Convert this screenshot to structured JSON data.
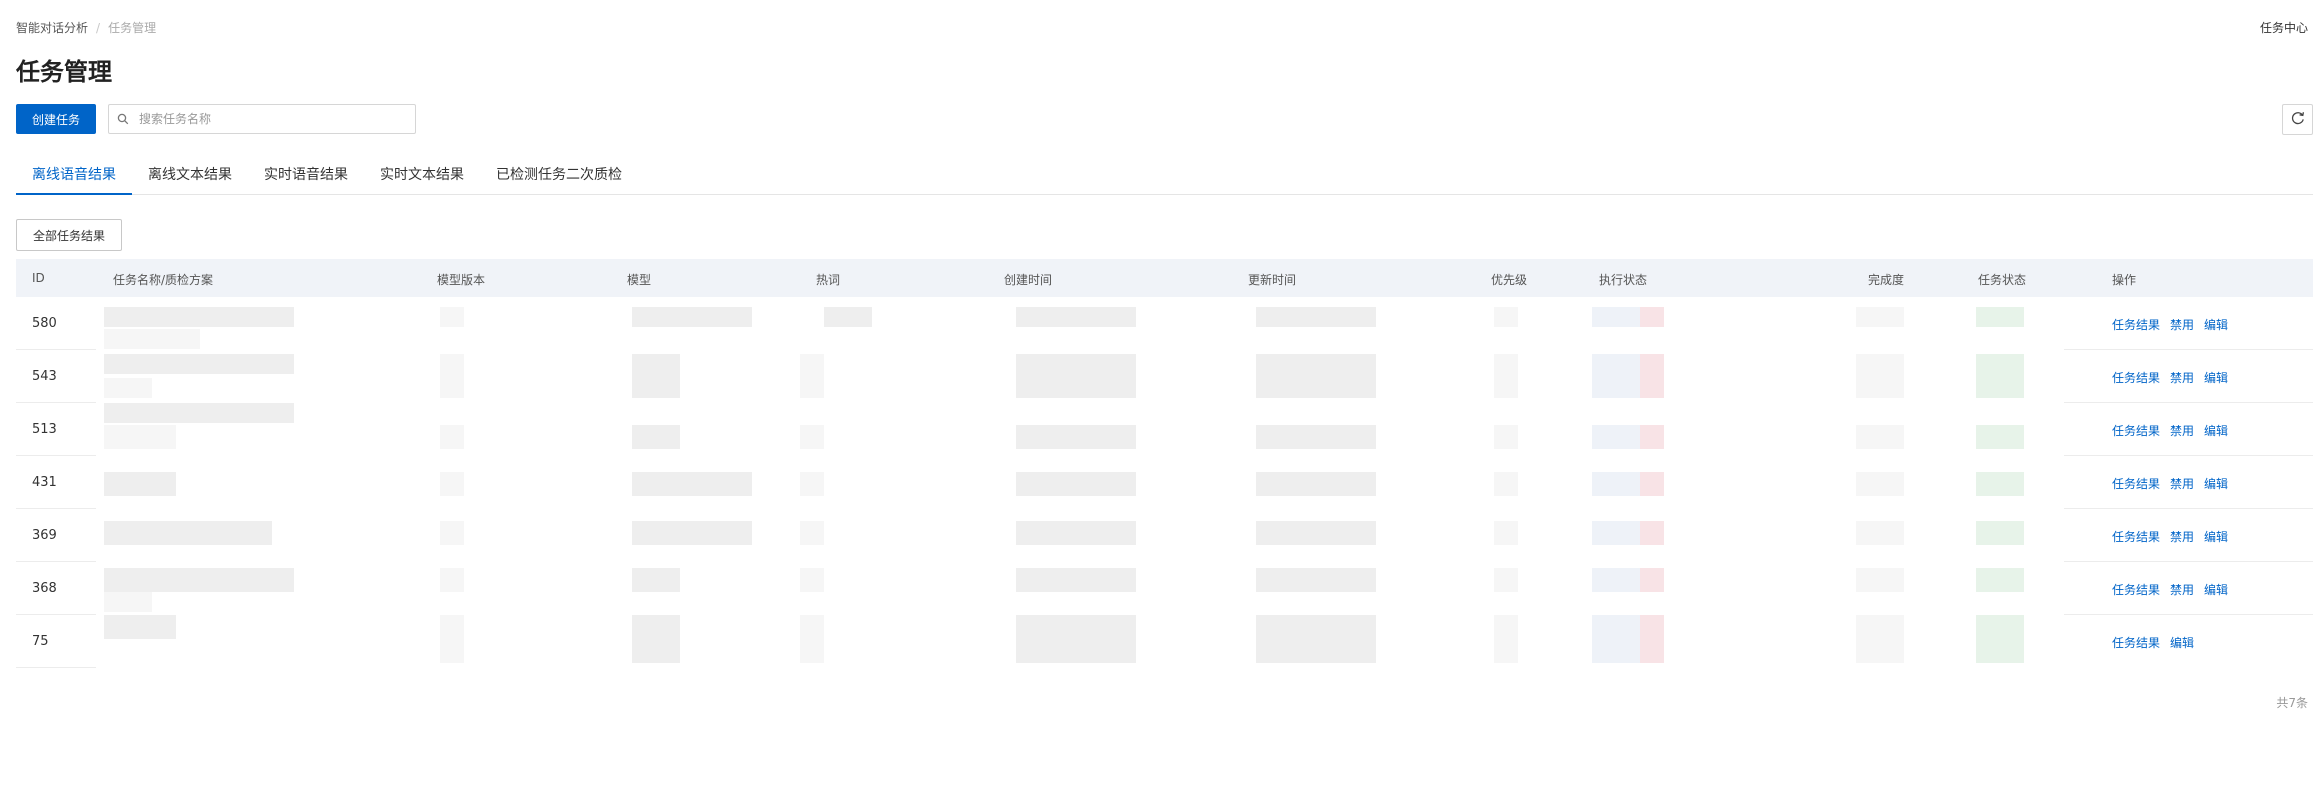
{
  "breadcrumb": {
    "parent": "智能对话分析",
    "current": "任务管理"
  },
  "header": {
    "task_center": "任务中心"
  },
  "page": {
    "title": "任务管理"
  },
  "toolbar": {
    "create_label": "创建任务",
    "search_placeholder": "搜索任务名称",
    "search_value": ""
  },
  "tabs": [
    {
      "label": "离线语音结果",
      "active": true
    },
    {
      "label": "离线文本结果",
      "active": false
    },
    {
      "label": "实时语音结果",
      "active": false
    },
    {
      "label": "实时文本结果",
      "active": false
    },
    {
      "label": "已检测任务二次质检",
      "active": false
    }
  ],
  "filter": {
    "label": "全部任务结果"
  },
  "table": {
    "headers": {
      "id": "ID",
      "name": "任务名称/质检方案",
      "model_version": "模型版本",
      "model": "模型",
      "hotword": "热词",
      "created": "创建时间",
      "updated": "更新时间",
      "priority": "优先级",
      "exec_status": "执行状态",
      "completion": "完成度",
      "task_status": "任务状态",
      "ops": "操作"
    },
    "rows": [
      {
        "id": "580",
        "ops": [
          "任务结果",
          "禁用",
          "编辑"
        ]
      },
      {
        "id": "543",
        "ops": [
          "任务结果",
          "禁用",
          "编辑"
        ]
      },
      {
        "id": "513",
        "ops": [
          "任务结果",
          "禁用",
          "编辑"
        ]
      },
      {
        "id": "431",
        "ops": [
          "任务结果",
          "禁用",
          "编辑"
        ]
      },
      {
        "id": "369",
        "ops": [
          "任务结果",
          "禁用",
          "编辑"
        ]
      },
      {
        "id": "368",
        "ops": [
          "任务结果",
          "禁用",
          "编辑"
        ]
      },
      {
        "id": "75",
        "ops": [
          "任务结果",
          "编辑"
        ]
      }
    ]
  },
  "footer": {
    "total": "共7条"
  },
  "colors": {
    "primary": "#0064c8",
    "header_bg": "#f0f3f8"
  },
  "icons": {
    "search": "search-icon",
    "refresh": "refresh-icon"
  }
}
